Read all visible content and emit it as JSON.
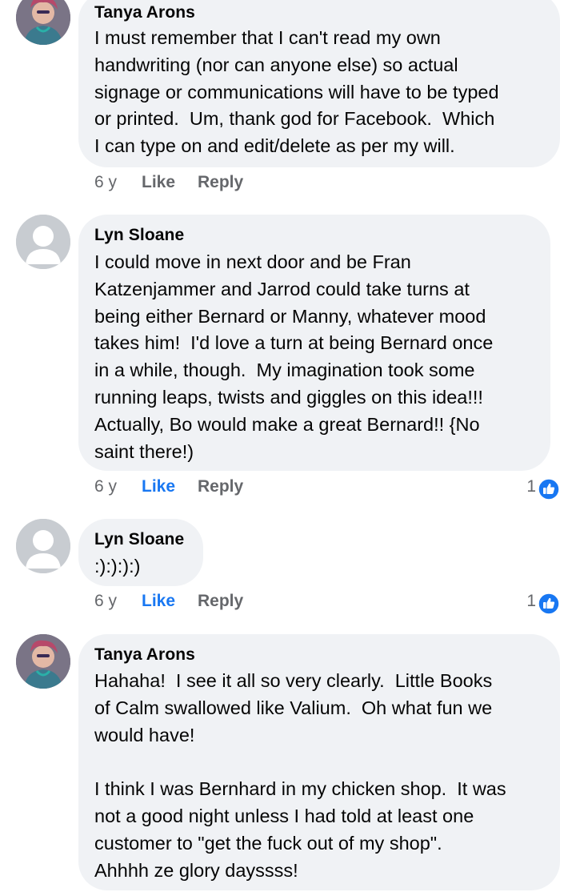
{
  "comments": [
    {
      "author": "Tanya Arons",
      "avatar": "photo",
      "text": "I must remember that I can't read my own\nhandwriting (nor can anyone else) so actual\nsignage or communications will have to be typed\nor printed.  Um, thank god for Facebook.  Which\nI can type on and edit/delete as per my will.",
      "time": "6 y",
      "like_label": "Like",
      "reply_label": "Reply",
      "liked": false,
      "reaction_count": ""
    },
    {
      "author": "Lyn Sloane",
      "avatar": "blank",
      "text": "I could move in next door and be Fran\nKatzenjammer and Jarrod could take turns at\nbeing either Bernard or Manny, whatever mood\ntakes him!  I'd love a turn at being Bernard once\nin a while, though.  My imagination took some\nrunning leaps, twists and giggles on this idea!!!\nActually, Bo would make a great Bernard!! {No\nsaint there!)",
      "time": "6 y",
      "like_label": "Like",
      "reply_label": "Reply",
      "liked": true,
      "reaction_count": "1"
    },
    {
      "author": "Lyn Sloane",
      "avatar": "blank",
      "text": ":):):):)",
      "time": "6 y",
      "like_label": "Like",
      "reply_label": "Reply",
      "liked": true,
      "reaction_count": "1"
    },
    {
      "author": "Tanya Arons",
      "avatar": "photo",
      "text": "Hahaha!  I see it all so very clearly.  Little Books\nof Calm swallowed like Valium.  Oh what fun we\nwould have!\n\nI think I was Bernhard in my chicken shop.  It was\nnot a good night unless I had told at least one\ncustomer to \"get the fuck out of my shop\".\nAhhhh ze glory dayssss!",
      "time": "",
      "like_label": "",
      "reply_label": "",
      "liked": false,
      "reaction_count": ""
    }
  ],
  "colors": {
    "bubble": "#f0f2f5",
    "like_active": "#1877f2",
    "meta": "#65676b"
  }
}
